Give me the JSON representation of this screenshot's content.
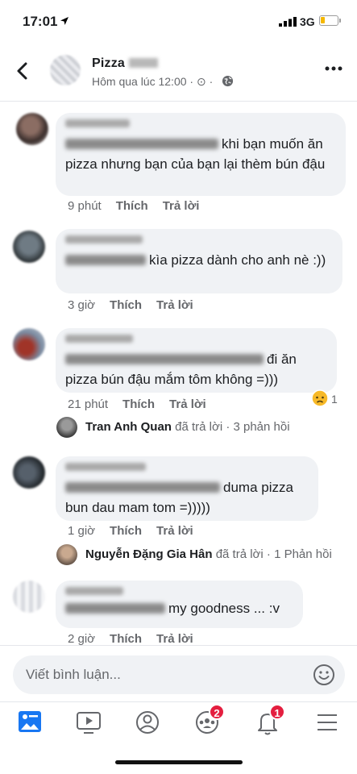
{
  "status_bar": {
    "time": "17:01",
    "network": "3G"
  },
  "header": {
    "title": "Pizza",
    "subtitle": "Hôm qua lúc 12:00 · ⊙ ·"
  },
  "comments": [
    {
      "text": "khi bạn muốn ăn pizza nhưng bạn của bạn lại thèm bún đậu",
      "time": "9 phút",
      "like": "Thích",
      "reply": "Trả lời"
    },
    {
      "text": "kìa pizza dành cho anh nè :))",
      "time": "3 giờ",
      "like": "Thích",
      "reply": "Trả lời"
    },
    {
      "text": "đi ăn pizza bún đậu mắm tôm không =)))",
      "time": "21 phút",
      "like": "Thích",
      "reply": "Trả lời",
      "reaction_count": "1"
    },
    {
      "text": "duma pizza bun dau mam tom =)))))",
      "time": "1 giờ",
      "like": "Thích",
      "reply": "Trả lời"
    },
    {
      "text": "my goodness ... :v",
      "time": "2 giờ",
      "like": "Thích",
      "reply": "Trả lời"
    }
  ],
  "replies": [
    {
      "name": "Tran Anh Quan",
      "action": "đã trả lời",
      "count": "· 3 phản hồi"
    },
    {
      "name": "Nguyễn Đặng Gia Hân",
      "action": "đã trả lời",
      "count": "· 1 Phản hồi"
    }
  ],
  "composer": {
    "placeholder": "Viết bình luận..."
  },
  "nav": {
    "groups_badge": "2",
    "notifications_badge": "1"
  },
  "colors": {
    "accent": "#1877f2",
    "badge": "#e41e3f",
    "bubble": "#f0f2f5",
    "meta": "#65676b"
  }
}
